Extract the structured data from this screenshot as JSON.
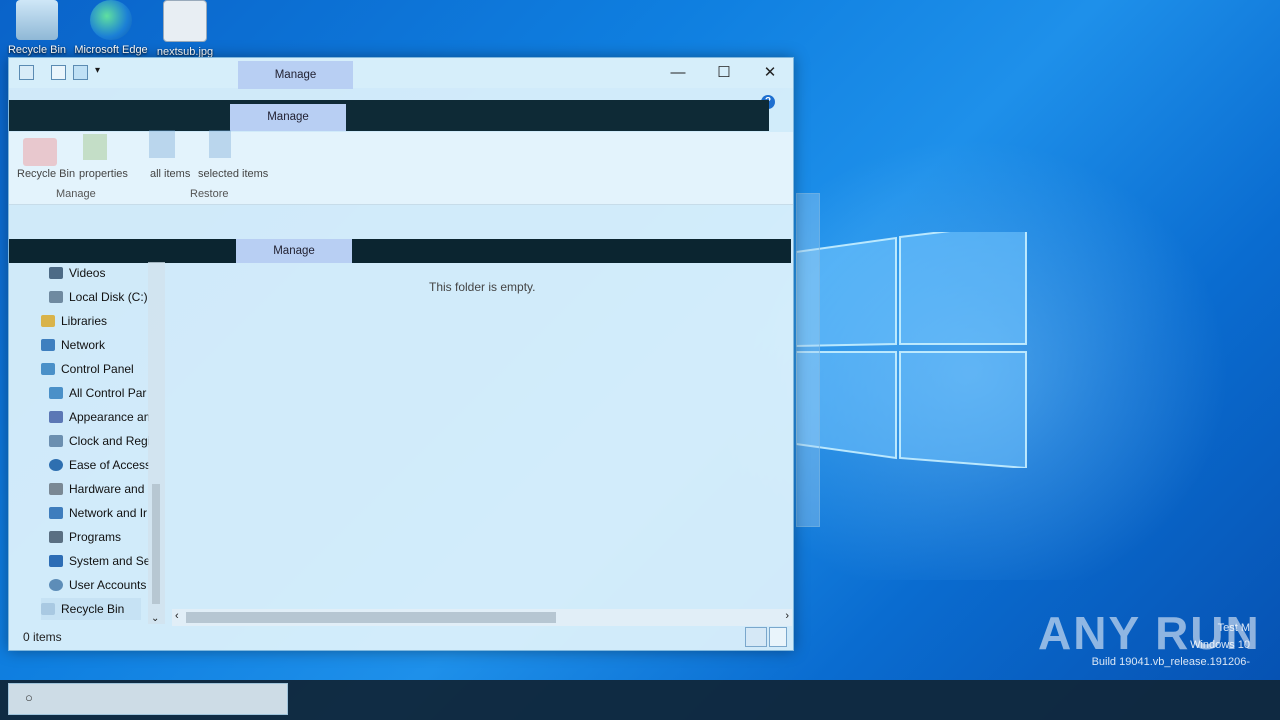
{
  "desktop": {
    "icons": [
      {
        "label": "Recycle Bin"
      },
      {
        "label": "Microsoft Edge"
      },
      {
        "label": "nextsub.jpg"
      }
    ]
  },
  "window": {
    "manage_label_top": "Manage",
    "manage_label_mid": "Manage",
    "manage_label_low": "Manage",
    "minimize": "—",
    "maximize": "☐",
    "close": "✕",
    "ribbon": {
      "empty_recycle_bin": "Recycle Bin",
      "properties": "properties",
      "restore_all": "all items",
      "restore_selected": "selected items",
      "group_manage": "Manage",
      "group_restore": "Restore"
    },
    "nav_items": [
      {
        "label": "Videos"
      },
      {
        "label": "Local Disk (C:)"
      },
      {
        "label": "Libraries"
      },
      {
        "label": "Network"
      },
      {
        "label": "Control Panel"
      },
      {
        "label": "All Control Par"
      },
      {
        "label": "Appearance an"
      },
      {
        "label": "Clock and Regi"
      },
      {
        "label": "Ease of Access"
      },
      {
        "label": "Hardware and"
      },
      {
        "label": "Network and Ir"
      },
      {
        "label": "Programs"
      },
      {
        "label": "System and Sec"
      },
      {
        "label": "User Accounts"
      },
      {
        "label": "Recycle Bin"
      }
    ],
    "empty_message": "This folder is empty.",
    "status": "0 items"
  },
  "watermark": {
    "brand": "ANY RUN",
    "line1": "Test M",
    "line2": "Windows 10",
    "line3": "Build 19041.vb_release.191206-"
  },
  "colors": {
    "accent": "#0a63c9",
    "manage_highlight": "#b8cff3",
    "dark_overlay": "#0e2a36"
  }
}
